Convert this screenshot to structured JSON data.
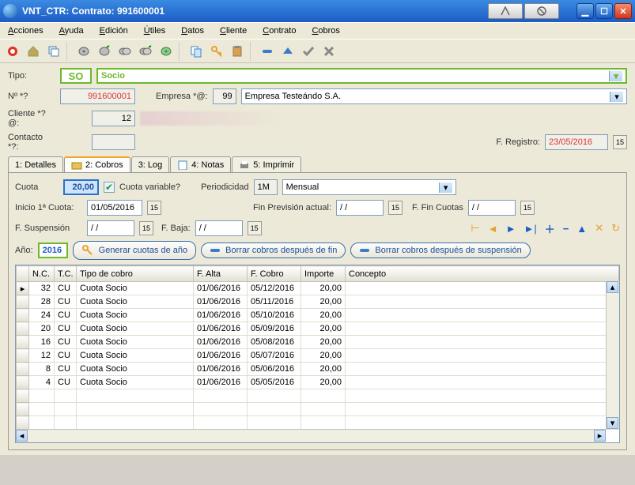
{
  "window": {
    "title": "VNT_CTR: Contrato: 991600001"
  },
  "menu": [
    "Acciones",
    "Ayuda",
    "Edición",
    "Útiles",
    "Datos",
    "Cliente",
    "Contrato",
    "Cobros"
  ],
  "tipo": {
    "label": "Tipo:",
    "code": "SO",
    "desc": "Socio"
  },
  "numero": {
    "label": "Nº *?",
    "value": "991600001"
  },
  "empresa": {
    "label": "Empresa *@:",
    "code": "99",
    "name": "Empresa Testeándo S.A."
  },
  "cliente": {
    "label": "Cliente *?@:",
    "value": "12"
  },
  "contacto": {
    "label": "Contacto *?:",
    "value": ""
  },
  "registro": {
    "label": "F. Registro:",
    "value": "23/05/2016"
  },
  "tabs": [
    "1: Detalles",
    "2: Cobros",
    "3: Log",
    "4: Notas",
    "5: Imprimir"
  ],
  "cobros": {
    "cuota_lbl": "Cuota",
    "cuota": "20,00",
    "var_lbl": "Cuota variable?",
    "per_lbl": "Periodicidad",
    "per_code": "1M",
    "per_name": "Mensual",
    "ini_lbl": "Inicio 1ª Cuota:",
    "ini": "01/05/2016",
    "finprev_lbl": "Fin Previsión actual:",
    "finprev": "/  /",
    "fincuot_lbl": "F. Fin Cuotas",
    "fincuot": "/  /",
    "susp_lbl": "F. Suspensión",
    "susp": "/  /",
    "baja_lbl": "F. Baja:",
    "baja": "/  /",
    "anio_lbl": "Año:",
    "anio": "2016",
    "gen_lbl": "Generar cuotas de año",
    "borr_fin": "Borrar cobros después de fin",
    "borr_susp": "Borrar cobros después de suspensión"
  },
  "grid": {
    "headers": [
      "",
      "N.C.",
      "T.C.",
      "Tipo de cobro",
      "F. Alta",
      "F. Cobro",
      "Importe",
      "Concepto"
    ],
    "rows": [
      {
        "nc": "32",
        "tc": "CU",
        "tipo": "Cuota Socio",
        "alta": "01/06/2016",
        "cobro": "05/12/2016",
        "imp": "20,00",
        "con": ""
      },
      {
        "nc": "28",
        "tc": "CU",
        "tipo": "Cuota Socio",
        "alta": "01/06/2016",
        "cobro": "05/11/2016",
        "imp": "20,00",
        "con": ""
      },
      {
        "nc": "24",
        "tc": "CU",
        "tipo": "Cuota Socio",
        "alta": "01/06/2016",
        "cobro": "05/10/2016",
        "imp": "20,00",
        "con": ""
      },
      {
        "nc": "20",
        "tc": "CU",
        "tipo": "Cuota Socio",
        "alta": "01/06/2016",
        "cobro": "05/09/2016",
        "imp": "20,00",
        "con": ""
      },
      {
        "nc": "16",
        "tc": "CU",
        "tipo": "Cuota Socio",
        "alta": "01/06/2016",
        "cobro": "05/08/2016",
        "imp": "20,00",
        "con": ""
      },
      {
        "nc": "12",
        "tc": "CU",
        "tipo": "Cuota Socio",
        "alta": "01/06/2016",
        "cobro": "05/07/2016",
        "imp": "20,00",
        "con": ""
      },
      {
        "nc": "8",
        "tc": "CU",
        "tipo": "Cuota Socio",
        "alta": "01/06/2016",
        "cobro": "05/06/2016",
        "imp": "20,00",
        "con": ""
      },
      {
        "nc": "4",
        "tc": "CU",
        "tipo": "Cuota Socio",
        "alta": "01/06/2016",
        "cobro": "05/05/2016",
        "imp": "20,00",
        "con": ""
      }
    ]
  }
}
